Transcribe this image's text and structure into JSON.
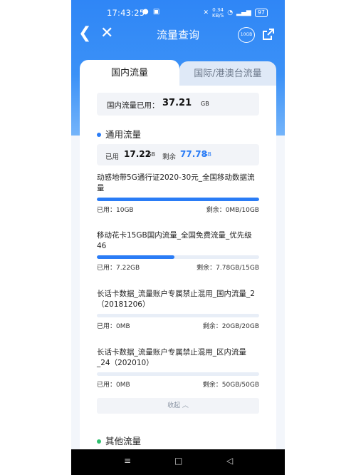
{
  "status": {
    "time": "17:43:25",
    "net_speed": "0.34",
    "net_unit": "KB/S",
    "battery": "97",
    "icons": [
      "chat-icon",
      "app-icon",
      "mute-icon",
      "wifi-icon",
      "signal-icon"
    ]
  },
  "nav": {
    "title": "流量查询",
    "badge": "10GB"
  },
  "tabs": [
    "国内流量",
    "国际/港澳台流量"
  ],
  "domestic": {
    "label": "国内流量已用：",
    "value": "37.21",
    "unit": "GB"
  },
  "general": {
    "title": "通用流量",
    "used_label": "已用",
    "used_value": "17.22",
    "used_unit": "GB",
    "remain_label": "剩余",
    "remain_value": "77.78",
    "remain_unit": "GB"
  },
  "packages": [
    {
      "name": "动感地带5G通行证2020-30元_全国移动数据流量",
      "used": "已用：10GB",
      "remain": "剩余：0MB/10GB",
      "progress": 1.0
    },
    {
      "name": "移动花卡15GB国内流量_全国免费流量_优先级46",
      "used": "已用：7.22GB",
      "remain": "剩余：7.78GB/15GB",
      "progress": 0.48
    },
    {
      "name": "长话卡数据_流量账户专属禁止混用_国内流量_2（20181206）",
      "used": "已用：0MB",
      "remain": "剩余：20GB/20GB",
      "progress": 0
    },
    {
      "name": "长话卡数据_流量账户专属禁止混用_区内流量_24（202010）",
      "used": "已用：0MB",
      "remain": "剩余：50GB/50GB",
      "progress": 0
    }
  ],
  "collapse_label": "收起 ︿",
  "other": {
    "title": "其他流量"
  },
  "bottom_nav": [
    "≡",
    "□",
    "◁"
  ]
}
